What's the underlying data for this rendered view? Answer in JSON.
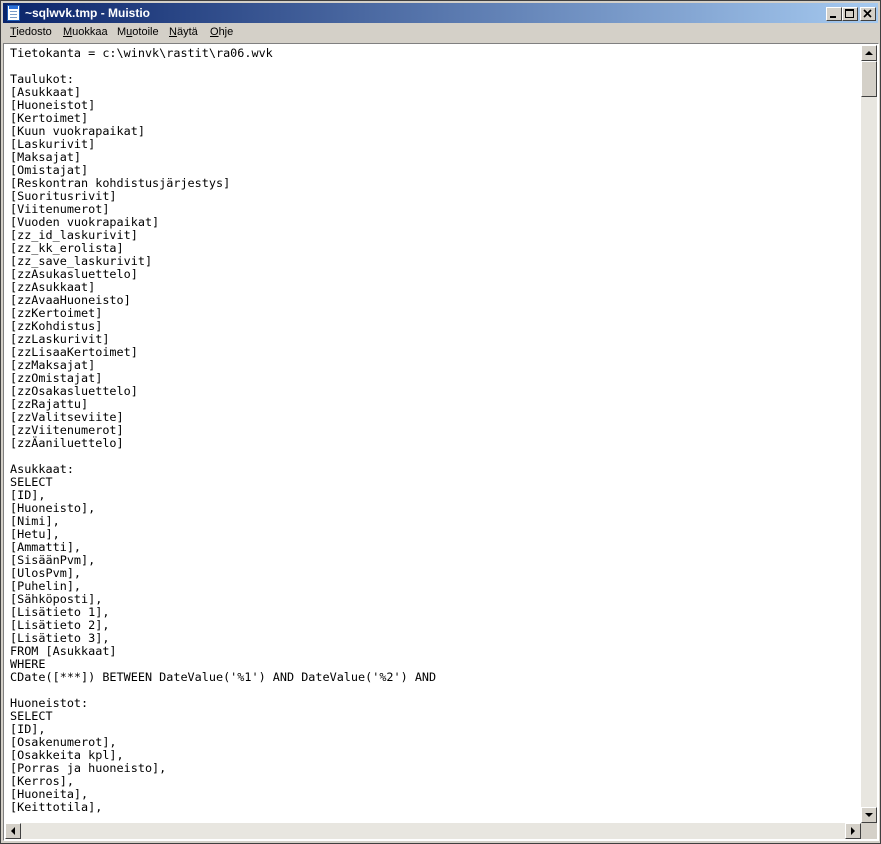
{
  "window": {
    "title": "~sqlwvk.tmp - Muistio",
    "icon": "notepad-icon",
    "controls": {
      "minimize": "0",
      "maximize": "1",
      "close": "r"
    }
  },
  "menu": [
    {
      "label": "Tiedosto",
      "underline": "T",
      "rest": "iedosto"
    },
    {
      "label": "Muokkaa",
      "underline": "M",
      "rest": "uokkaa"
    },
    {
      "label": "Muotoile",
      "prefix": "M",
      "underline": "u",
      "rest": "otoile"
    },
    {
      "label": "Näytä",
      "underline": "N",
      "rest": "äytä"
    },
    {
      "label": "Ohje",
      "underline": "O",
      "rest": "hje"
    }
  ],
  "editor": {
    "content": "Tietokanta = c:\\winvk\\rastit\\ra06.wvk\n\nTaulukot:\n[Asukkaat]\n[Huoneistot]\n[Kertoimet]\n[Kuun vuokrapaikat]\n[Laskurivit]\n[Maksajat]\n[Omistajat]\n[Reskontran kohdistusjärjestys]\n[Suoritusrivit]\n[Viitenumerot]\n[Vuoden vuokrapaikat]\n[zz_id_laskurivit]\n[zz_kk_erolista]\n[zz_save_laskurivit]\n[zzAsukasluettelo]\n[zzAsukkaat]\n[zzAvaaHuoneisto]\n[zzKertoimet]\n[zzKohdistus]\n[zzLaskurivit]\n[zzLisaaKertoimet]\n[zzMaksajat]\n[zzOmistajat]\n[zzOsakasluettelo]\n[zzRajattu]\n[zzValitseviite]\n[zzViitenumerot]\n[zzÄaniluettelo]\n\nAsukkaat:\nSELECT\n[ID],\n[Huoneisto],\n[Nimi],\n[Hetu],\n[Ammatti],\n[SisäänPvm],\n[UlosPvm],\n[Puhelin],\n[Sähköposti],\n[Lisätieto 1],\n[Lisätieto 2],\n[Lisätieto 3],\nFROM [Asukkaat]\nWHERE\nCDate([***]) BETWEEN DateValue('%1') AND DateValue('%2') AND\n\nHuoneistot:\nSELECT\n[ID],\n[Osakenumerot],\n[Osakkeita kpl],\n[Porras ja huoneisto],\n[Kerros],\n[Huoneita],\n[Keittotila],"
  },
  "scrollbars": {
    "up_icon": "scroll-up-arrow-icon",
    "down_icon": "scroll-down-arrow-icon",
    "left_icon": "scroll-left-arrow-icon",
    "right_icon": "scroll-right-arrow-icon"
  }
}
